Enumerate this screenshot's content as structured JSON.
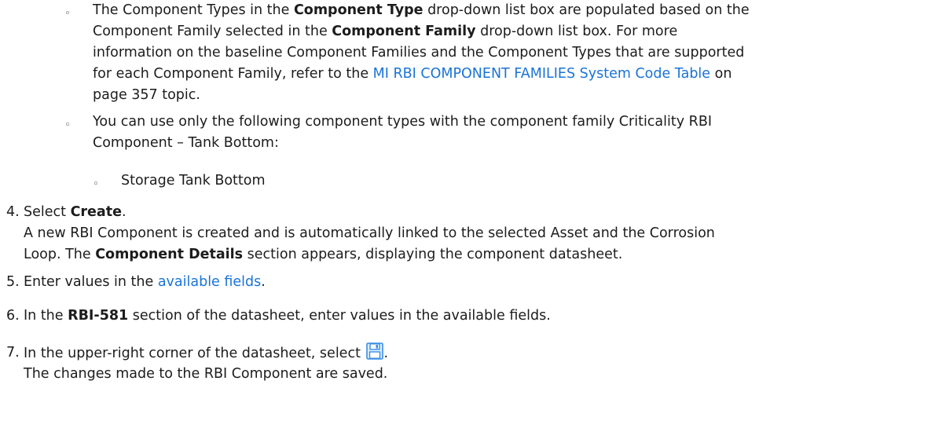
{
  "bullets": {
    "b1": {
      "l1_pre": "The Component Types in the ",
      "l1_bold1": "Component Type",
      "l1_post": " drop-down list box are populated based on the",
      "l2_pre": "Component Family selected in the ",
      "l2_bold": "Component Family",
      "l2_post": " drop-down list box. For more",
      "l3": "information on the baseline Component Families and the Component Types that are supported",
      "l4_pre": "for each Component Family, refer to the ",
      "l4_link": "MI RBI COMPONENT FAMILIES System Code Table",
      "l4_post": " on",
      "l5": "page 357 topic."
    },
    "b2": {
      "l1": "You can use only the following component types with the component family Criticality RBI",
      "l2": "Component – Tank Bottom:"
    },
    "b3": {
      "l1": "Storage Tank Bottom"
    },
    "bullet_char": "◦"
  },
  "steps": {
    "s4": {
      "num": "4.",
      "l1_pre": "Select ",
      "l1_bold": "Create",
      "l1_post": ".",
      "l2": "A new RBI Component is created and is automatically linked to the selected Asset and the Corrosion",
      "l3_pre": "Loop. The ",
      "l3_bold": "Component Details",
      "l3_post": " section appears, displaying the component datasheet."
    },
    "s5": {
      "num": "5.",
      "pre": "Enter values in the ",
      "link": "available fields",
      "post": "."
    },
    "s6": {
      "num": "6.",
      "pre": "In the ",
      "bold": "RBI-581",
      "post": " section of the datasheet, enter values in the available fields."
    },
    "s7": {
      "num": "7.",
      "l1_pre": "In the upper-right corner of the datasheet, select ",
      "l1_post": ".",
      "l2": "The changes made to the RBI Component are saved."
    }
  },
  "icons": {
    "save": "save-icon",
    "save_color": "#3a8ee6"
  }
}
